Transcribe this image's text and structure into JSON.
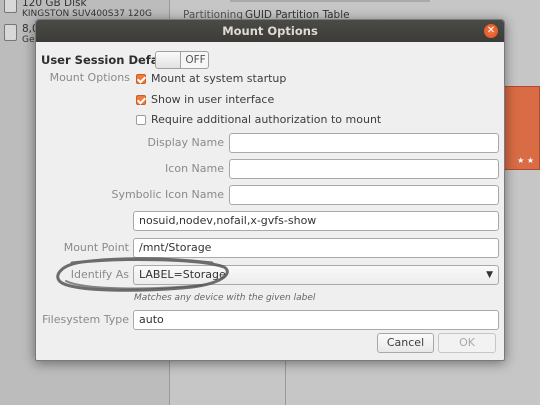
{
  "background": {
    "disks": [
      {
        "title": "120 GB Disk",
        "subtitle": "KINGSTON SUV400S37 120G"
      },
      {
        "title": "8,0",
        "subtitle": "Ge"
      }
    ],
    "properties": {
      "label": "Partitioning",
      "value": "GUID Partition Table"
    }
  },
  "dialog": {
    "title": "Mount Options",
    "section_title": "User Session Defaults",
    "toggle_label": "OFF",
    "mount_options_label": "Mount Options",
    "checkboxes": [
      {
        "label": "Mount at system startup",
        "checked": true
      },
      {
        "label": "Show in user interface",
        "checked": true
      },
      {
        "label": "Require additional authorization to mount",
        "checked": false
      }
    ],
    "display_name_label": "Display Name",
    "display_name_value": "",
    "icon_name_label": "Icon Name",
    "icon_name_value": "",
    "symbolic_icon_name_label": "Symbolic Icon Name",
    "symbolic_icon_name_value": "",
    "options_value": "nosuid,nodev,nofail,x-gvfs-show",
    "mount_point_label": "Mount Point",
    "mount_point_value": "/mnt/Storage",
    "identify_as_label": "Identify As",
    "identify_as_value": "LABEL=Storage",
    "identify_hint": "Matches any device with the given label",
    "filesystem_type_label": "Filesystem Type",
    "filesystem_type_value": "auto",
    "cancel_label": "Cancel",
    "ok_label": "OK"
  },
  "colors": {
    "accent": "#ee7a3b",
    "titlebar": "#3c3b37",
    "close": "#e0511d",
    "partition": "#d96b45"
  }
}
